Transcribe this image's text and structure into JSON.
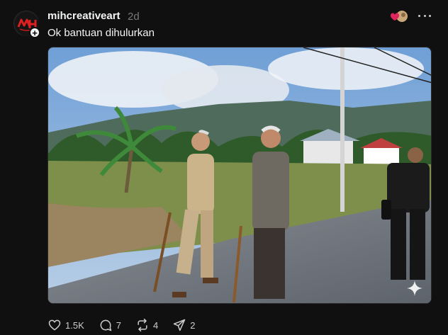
{
  "post": {
    "username": "mihcreativeart",
    "timestamp": "2d",
    "caption": "Ok bantuan dihulurkan",
    "avatar_text": "MH",
    "follow_icon": "+",
    "image_alt": "Two elderly men walking with canes along a village road"
  },
  "actions": {
    "likes": "1.5K",
    "comments": "7",
    "reposts": "4",
    "shares": "2"
  },
  "icons": {
    "like": "heart-icon",
    "comment": "comment-icon",
    "repost": "repost-icon",
    "share": "send-icon",
    "more": "more-icon",
    "ai": "sparkle-icon"
  },
  "colors": {
    "background": "#101010",
    "text": "#f3f5f7",
    "muted": "#777777",
    "like_red": "#e0245e"
  }
}
